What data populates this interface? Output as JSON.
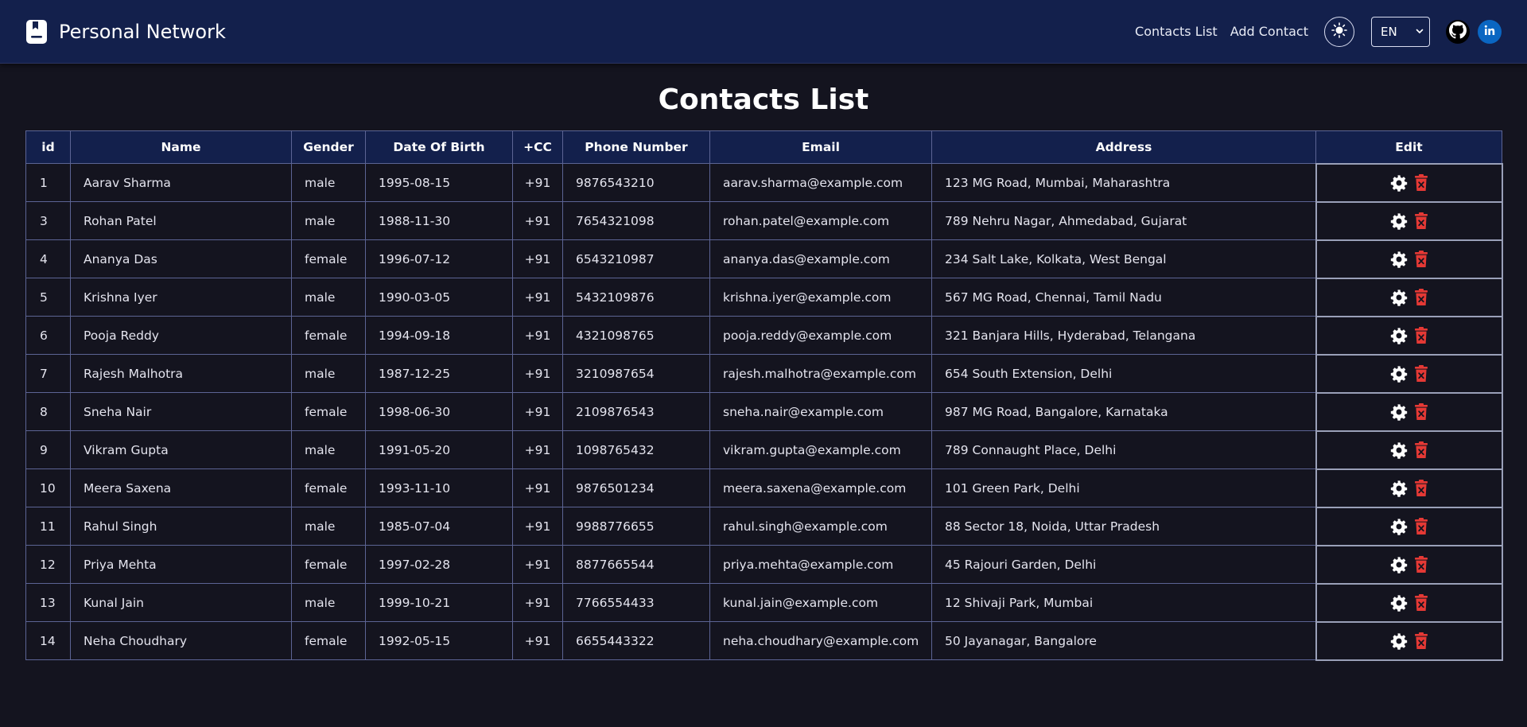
{
  "app": {
    "title": "Personal Network"
  },
  "nav": {
    "contacts_list": "Contacts List",
    "add_contact": "Add Contact",
    "language": "EN"
  },
  "page": {
    "title": "Contacts List"
  },
  "table": {
    "headers": [
      "id",
      "Name",
      "Gender",
      "Date Of Birth",
      "+CC",
      "Phone Number",
      "Email",
      "Address",
      "Edit"
    ],
    "rows": [
      {
        "id": "1",
        "name": "Aarav Sharma",
        "gender": "male",
        "dob": "1995-08-15",
        "cc": "+91",
        "phone": "9876543210",
        "email": "aarav.sharma@example.com",
        "address": "123 MG Road, Mumbai, Maharashtra"
      },
      {
        "id": "3",
        "name": "Rohan Patel",
        "gender": "male",
        "dob": "1988-11-30",
        "cc": "+91",
        "phone": "7654321098",
        "email": "rohan.patel@example.com",
        "address": "789 Nehru Nagar, Ahmedabad, Gujarat"
      },
      {
        "id": "4",
        "name": "Ananya Das",
        "gender": "female",
        "dob": "1996-07-12",
        "cc": "+91",
        "phone": "6543210987",
        "email": "ananya.das@example.com",
        "address": "234 Salt Lake, Kolkata, West Bengal"
      },
      {
        "id": "5",
        "name": "Krishna Iyer",
        "gender": "male",
        "dob": "1990-03-05",
        "cc": "+91",
        "phone": "5432109876",
        "email": "krishna.iyer@example.com",
        "address": "567 MG Road, Chennai, Tamil Nadu"
      },
      {
        "id": "6",
        "name": "Pooja Reddy",
        "gender": "female",
        "dob": "1994-09-18",
        "cc": "+91",
        "phone": "4321098765",
        "email": "pooja.reddy@example.com",
        "address": "321 Banjara Hills, Hyderabad, Telangana"
      },
      {
        "id": "7",
        "name": "Rajesh Malhotra",
        "gender": "male",
        "dob": "1987-12-25",
        "cc": "+91",
        "phone": "3210987654",
        "email": "rajesh.malhotra@example.com",
        "address": "654 South Extension, Delhi"
      },
      {
        "id": "8",
        "name": "Sneha Nair",
        "gender": "female",
        "dob": "1998-06-30",
        "cc": "+91",
        "phone": "2109876543",
        "email": "sneha.nair@example.com",
        "address": "987 MG Road, Bangalore, Karnataka"
      },
      {
        "id": "9",
        "name": "Vikram Gupta",
        "gender": "male",
        "dob": "1991-05-20",
        "cc": "+91",
        "phone": "1098765432",
        "email": "vikram.gupta@example.com",
        "address": "789 Connaught Place, Delhi"
      },
      {
        "id": "10",
        "name": "Meera Saxena",
        "gender": "female",
        "dob": "1993-11-10",
        "cc": "+91",
        "phone": "9876501234",
        "email": "meera.saxena@example.com",
        "address": "101 Green Park, Delhi"
      },
      {
        "id": "11",
        "name": "Rahul Singh",
        "gender": "male",
        "dob": "1985-07-04",
        "cc": "+91",
        "phone": "9988776655",
        "email": "rahul.singh@example.com",
        "address": "88 Sector 18, Noida, Uttar Pradesh"
      },
      {
        "id": "12",
        "name": "Priya Mehta",
        "gender": "female",
        "dob": "1997-02-28",
        "cc": "+91",
        "phone": "8877665544",
        "email": "priya.mehta@example.com",
        "address": "45 Rajouri Garden, Delhi"
      },
      {
        "id": "13",
        "name": "Kunal Jain",
        "gender": "male",
        "dob": "1999-10-21",
        "cc": "+91",
        "phone": "7766554433",
        "email": "kunal.jain@example.com",
        "address": "12 Shivaji Park, Mumbai"
      },
      {
        "id": "14",
        "name": "Neha Choudhary",
        "gender": "female",
        "dob": "1992-05-15",
        "cc": "+91",
        "phone": "6655443322",
        "email": "neha.choudhary@example.com",
        "address": "50 Jayanagar, Bangalore"
      }
    ]
  },
  "icons": {
    "brand": "contact-book-icon",
    "theme": "sun-icon",
    "select_arrow": "chevron-down-icon",
    "github": "github-icon",
    "linkedin": "linkedin-icon",
    "edit": "gear-icon",
    "delete": "trash-icon"
  },
  "colors": {
    "navbar_bg": "#13204c",
    "page_bg": "#14141f",
    "delete_red": "#e53935",
    "linkedin_blue": "#0a66c2"
  }
}
